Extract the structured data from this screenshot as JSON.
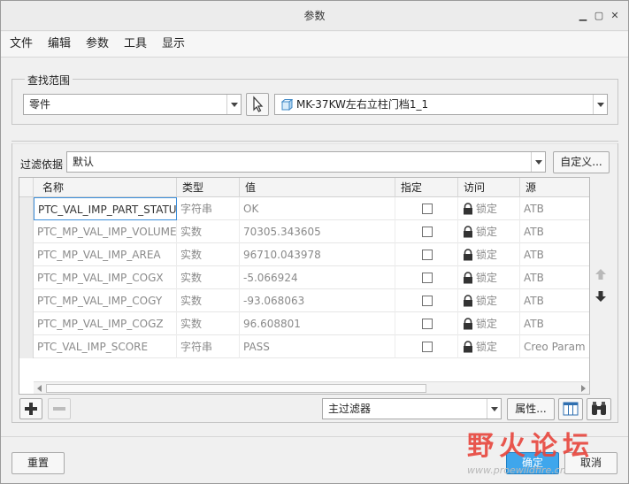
{
  "window": {
    "title": "参数"
  },
  "menu": [
    "文件",
    "编辑",
    "参数",
    "工具",
    "显示"
  ],
  "scope": {
    "label": "查找范围",
    "type_value": "零件",
    "model_value": "MK-37KW左右立柱门档1_1"
  },
  "filter": {
    "label": "过滤依据",
    "value": "默认",
    "customize_label": "自定义..."
  },
  "table": {
    "columns": [
      "名称",
      "类型",
      "值",
      "指定",
      "访问",
      "源"
    ],
    "rows": [
      {
        "name": "PTC_VAL_IMP_PART_STATUS",
        "type": "字符串",
        "value": "OK",
        "access": "锁定",
        "source": "ATB"
      },
      {
        "name": "PTC_MP_VAL_IMP_VOLUME",
        "type": "实数",
        "value": "70305.343605",
        "access": "锁定",
        "source": "ATB"
      },
      {
        "name": "PTC_MP_VAL_IMP_AREA",
        "type": "实数",
        "value": "96710.043978",
        "access": "锁定",
        "source": "ATB"
      },
      {
        "name": "PTC_MP_VAL_IMP_COGX",
        "type": "实数",
        "value": "-5.066924",
        "access": "锁定",
        "source": "ATB"
      },
      {
        "name": "PTC_MP_VAL_IMP_COGY",
        "type": "实数",
        "value": "-93.068063",
        "access": "锁定",
        "source": "ATB"
      },
      {
        "name": "PTC_MP_VAL_IMP_COGZ",
        "type": "实数",
        "value": "96.608801",
        "access": "锁定",
        "source": "ATB"
      },
      {
        "name": "PTC_VAL_IMP_SCORE",
        "type": "字符串",
        "value": "PASS",
        "access": "锁定",
        "source": "Creo Param"
      }
    ]
  },
  "bottom": {
    "main_filter_value": "主过滤器",
    "properties_label": "属性..."
  },
  "footer": {
    "reset_label": "重置",
    "ok_label": "确定",
    "cancel_label": "取消"
  },
  "watermark": {
    "text": "野火论坛",
    "url": "www.proewildfire.cn"
  },
  "colors": {
    "selection": "#3b8edb",
    "ok_button": "#1e90e8",
    "watermark": "#e8453c"
  }
}
